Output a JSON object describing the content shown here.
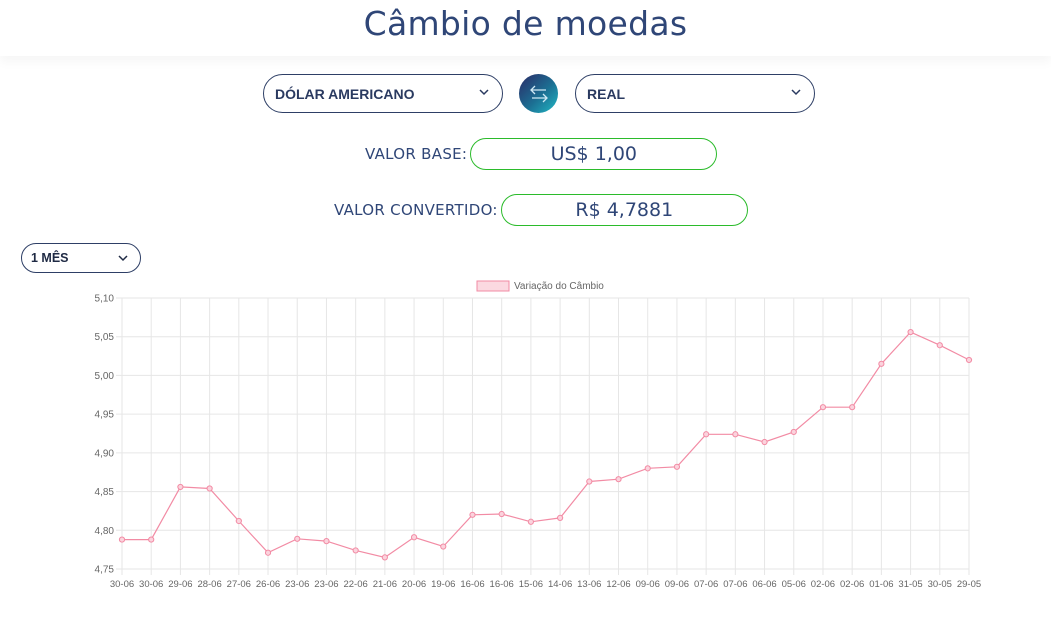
{
  "header": {
    "title": "Câmbio de moedas"
  },
  "converter": {
    "from_currency": "DÓLAR AMERICANO",
    "to_currency": "REAL",
    "base_label": "VALOR BASE:",
    "base_value": "US$ 1,00",
    "converted_label": "VALOR CONVERTIDO:",
    "converted_value": "R$ 4,7881"
  },
  "period": {
    "selected": "1 MÊS"
  },
  "colors": {
    "title": "#2f4677",
    "border": "#2e3f66",
    "field_border": "#2bbb2b",
    "line": "#f28ba4",
    "point_fill": "#fbd3dd"
  },
  "icons": {
    "swap": "swap-arrows-icon",
    "dropdown": "chevron-down-icon"
  },
  "chart_data": {
    "type": "line",
    "legend": "Variação do Câmbio",
    "legend_position": "top-center",
    "grid": true,
    "ylim": [
      4.75,
      5.1
    ],
    "yticks": [
      "5,10",
      "5,05",
      "5,00",
      "4,95",
      "4,90",
      "4,85",
      "4,80",
      "4,75"
    ],
    "ytick_values": [
      5.1,
      5.05,
      5.0,
      4.95,
      4.9,
      4.85,
      4.8,
      4.75
    ],
    "categories": [
      "30-06",
      "30-06",
      "29-06",
      "28-06",
      "27-06",
      "26-06",
      "23-06",
      "23-06",
      "22-06",
      "21-06",
      "20-06",
      "19-06",
      "16-06",
      "16-06",
      "15-06",
      "14-06",
      "13-06",
      "12-06",
      "09-06",
      "09-06",
      "07-06",
      "07-06",
      "06-06",
      "05-06",
      "02-06",
      "02-06",
      "01-06",
      "31-05",
      "30-05",
      "29-05"
    ],
    "series": [
      {
        "name": "Variação do Câmbio",
        "values": [
          4.788,
          4.788,
          4.856,
          4.854,
          4.812,
          4.771,
          4.789,
          4.786,
          4.774,
          4.765,
          4.791,
          4.779,
          4.82,
          4.821,
          4.811,
          4.816,
          4.863,
          4.866,
          4.88,
          4.882,
          4.924,
          4.924,
          4.914,
          4.927,
          4.959,
          4.959,
          5.015,
          5.056,
          5.039,
          5.02
        ]
      }
    ]
  }
}
